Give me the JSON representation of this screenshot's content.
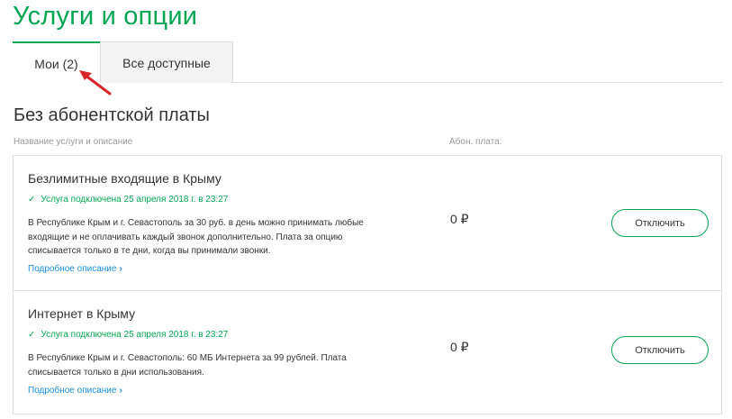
{
  "page_title": "Услуги и опции",
  "tabs": [
    {
      "label": "Мои (2)",
      "active": true
    },
    {
      "label": "Все доступные",
      "active": false
    }
  ],
  "section_title": "Без абонентской платы",
  "columns": {
    "name": "Название услуги и описание",
    "fee": "Абон. плата:"
  },
  "services": [
    {
      "name": "Безлимитные входящие в Крыму",
      "status": "Услуга подключена 25 апреля 2018 г. в 23:27",
      "description": "В Республике Крым и г. Севастополь за 30 руб. в день можно принимать любые входящие и не оплачивать каждый звонок дополнительно. Плата за опцию списывается только в те дни, когда вы принимали звонки.",
      "link": "Подробное описание",
      "fee": "0 ₽",
      "button": "Отключить"
    },
    {
      "name": "Интернет в Крыму",
      "status": "Услуга подключена 25 апреля 2018 г. в 23:27",
      "description": "В Республике Крым и г. Севастополь: 60 МБ Интернета за 99 рублей. Плата списывается только в дни использования.",
      "link": "Подробное описание",
      "fee": "0 ₽",
      "button": "Отключить"
    }
  ],
  "colors": {
    "accent": "#00a651",
    "link": "#1a8fd8",
    "annotation_arrow": "#d9252a"
  },
  "icons": {
    "status": "check-icon",
    "link": "chevron-right-icon",
    "annotation": "red-arrow-icon"
  }
}
